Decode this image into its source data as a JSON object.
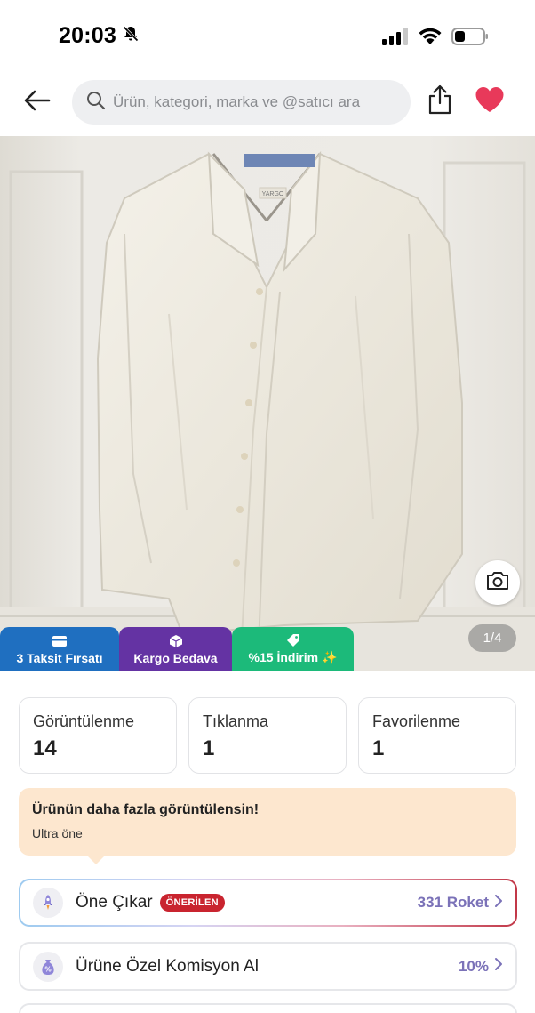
{
  "status_bar": {
    "time": "20:03",
    "icons": [
      "bell-slash-icon",
      "cellular-signal-icon",
      "wifi-icon",
      "battery-icon"
    ]
  },
  "header": {
    "back_icon": "arrow-left-icon",
    "search_placeholder": "Ürün, kategori, marka ve @satıcı ara",
    "share_icon": "share-icon",
    "favorite_icon": "heart-icon"
  },
  "gallery": {
    "image_alt": "white shirt on hanger",
    "counter": "1/4",
    "camera_icon": "camera-icon",
    "shirt_label": "YARGO"
  },
  "badges": [
    {
      "label": "3 Taksit Fırsatı",
      "icon": "card-icon",
      "color": "#1f6fc0"
    },
    {
      "label": "Kargo Bedava",
      "icon": "box-icon",
      "color": "#6433a3"
    },
    {
      "label": "%15 İndirim ✨",
      "icon": "tag-icon",
      "color": "#1cba7a"
    }
  ],
  "stats": [
    {
      "label": "Görüntülenme",
      "value": "14"
    },
    {
      "label": "Tıklanma",
      "value": "1"
    },
    {
      "label": "Favorilenme",
      "value": "1"
    }
  ],
  "promo": {
    "title": "Ürünün daha fazla görüntülensin!",
    "subtitle": "Ultra öne"
  },
  "actions": [
    {
      "label": "Öne Çıkar",
      "pill": "ÖNERİLEN",
      "value": "331 Roket",
      "icon": "rocket-icon"
    },
    {
      "label": "Ürüne Özel Komisyon Al",
      "value": "10%",
      "icon": "money-bag-icon"
    }
  ],
  "colors": {
    "accent_purple": "#7b72b8",
    "heart_red": "#e8395a",
    "recommended_red": "#c9242f",
    "promo_bg": "#fde7cf"
  }
}
